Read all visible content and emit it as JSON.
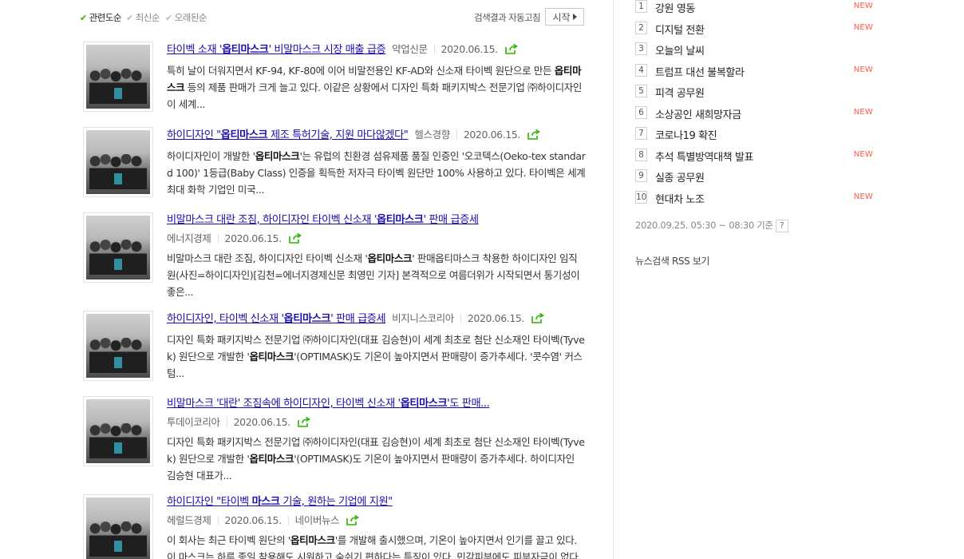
{
  "sort": {
    "options": [
      "관련도순",
      "최신순",
      "오래된순"
    ],
    "active_index": 0,
    "auto_refresh_label": "검색결과 자동고침",
    "start_label": "시작"
  },
  "results": [
    {
      "title": [
        "타이벡 소재 '",
        "옵티마스크",
        "' 비말마스크 시장 매출 급증"
      ],
      "source": "약업신문",
      "date": "2020.06.15.",
      "desc": [
        "특히 날이 더워지면서 KF-94, KF-80에 이어 비말전용인 KF-AD와 신소재 타이벡 원단으로 만든 ",
        "옵티마스크",
        " 등의 제품 판매가 크게 늘고 있다. 이같은 상황에서 디자인 특화 패키지박스 전문기업 ㈜하이디자인이 세계..."
      ]
    },
    {
      "title": [
        "하이디자인 \"",
        "옵티마스크",
        " 제조 특허기술, 지원 마다않겠다\""
      ],
      "source": "헬스경향",
      "date": "2020.06.15.",
      "desc": [
        "하이디자인이 개발한 '",
        "옵티마스크",
        "'는 유럽의 친환경 섬유제품 품질 인증인 '오코텍스(Oeko-tex standard 100)' 1등급(Baby Class) 인증을 획득한 저자극 타이벡 원단만 100% 사용하고 있다. 타이벡은 세계 최대 화학 기업인 미국..."
      ]
    },
    {
      "title": [
        "비말마스크 대란 조짐, 하이디자인 타이벡 신소재 '",
        "옵티마스크",
        "' 판매 급증세"
      ],
      "source": "에너지경제",
      "date": "2020.06.15.",
      "desc": [
        "비말마스크 대란 조짐, 하이디자인 타이벡 신소재 '",
        "옵티마스크",
        "' 판매옵티마스크 착용한 하이디자인 임직원(사진=하이디자인)[김천=에너지경제신문 최영민 기자] 본격적으로 여름더위가 시작되면서 통기성이 좋은..."
      ]
    },
    {
      "title": [
        "하이디자인, 타이벡 신소재 '",
        "옵티마스크",
        "' 판매 급증세"
      ],
      "source": "비지니스코리아",
      "date": "2020.06.15.",
      "desc": [
        " 디자인 특화 패키지박스 전문기업 ㈜하이디자인(대표 김승현)이 세계 최초로 첨단 신소재인 타이벡(Tyvek) 원단으로 개발한 '",
        "옵티마스크",
        "'(OPTIMASK)도 기온이 높아지면서 판매량이 증가추세다. '콧수염' 커스텀..."
      ]
    },
    {
      "title": [
        "비말마스크 '대란' 조짐속에 하이디자인, 타이벡 신소재 '",
        "옵티마스크",
        "'도 판매..."
      ],
      "source": "투데이코리아",
      "date": "2020.06.15.",
      "desc": [
        "디자인 특화 패키지박스 전문기업 ㈜하이디자인(대표 김승현)이 세계 최초로 첨단 신소재인 타이벡(Tyvek) 원단으로 개발한 '",
        "옵티마스크",
        "'(OPTIMASK)도 기온이 높아지면서 판매량이 증가추세다. 하이디자인 김승현 대표가..."
      ]
    },
    {
      "title": [
        "하이디자인 \"타이벡 ",
        "마스크",
        " 기술, 원하는 기업에 지원\""
      ],
      "source": "헤럴드경제",
      "date": "2020.06.15.",
      "extra": "네이버뉴스",
      "desc": [
        "이 회사는 최근 타이벡 원단의 '",
        "옵티마스크",
        "'를 개발해 출시했으며, 기온이 높아지면서 인기를 끌고 있다. 이 마스크는 하루 종일 착용해도 시원하고 숨쉬기 편하다는 특징이 있다. 민감피부에도 피부자극이 없다고..."
      ]
    }
  ],
  "ranking": [
    {
      "num": "1",
      "keyword": "강원 영동",
      "is_new": true
    },
    {
      "num": "2",
      "keyword": "디지털 전환",
      "is_new": true
    },
    {
      "num": "3",
      "keyword": "오늘의 날씨",
      "is_new": false
    },
    {
      "num": "4",
      "keyword": "트럼프 대선 불복할라",
      "is_new": true
    },
    {
      "num": "5",
      "keyword": "피격 공무원",
      "is_new": false
    },
    {
      "num": "6",
      "keyword": "소상공인 새희망자금",
      "is_new": true
    },
    {
      "num": "7",
      "keyword": "코로나19 확진",
      "is_new": false
    },
    {
      "num": "8",
      "keyword": "추석 특별방역대책 발표",
      "is_new": true
    },
    {
      "num": "9",
      "keyword": "실종 공무원",
      "is_new": false
    },
    {
      "num": "10",
      "keyword": "현대차 노조",
      "is_new": true
    }
  ],
  "new_label": "NEW",
  "ranking_time": "2020.09.25. 05:30 ~ 08:30 기준",
  "help_label": "?",
  "rss_label": "뉴스검색 RSS 보기",
  "colors": {
    "link": "#1a0dab",
    "accent_green": "#2db400",
    "new_red": "#ff5a4a"
  },
  "icons": {
    "share": "share-icon",
    "check": "check-icon"
  }
}
